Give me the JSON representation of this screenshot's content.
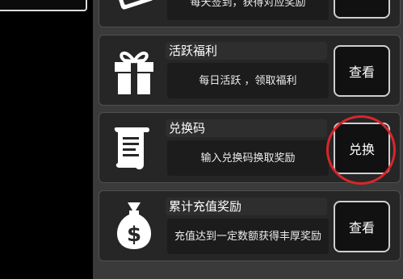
{
  "cards": [
    {
      "title": "",
      "desc": "每天签到，获得对应奖励",
      "button": "查看",
      "icon": "checkin-icon"
    },
    {
      "title": "活跃福利",
      "desc": "每日活跃 ，领取福利",
      "button": "查看",
      "icon": "gift-icon"
    },
    {
      "title": "兑换码",
      "desc": "输入兑换码换取奖励",
      "button": "兑换",
      "icon": "scroll-icon"
    },
    {
      "title": "累计充值奖励",
      "desc": "充值达到一定数额获得丰厚奖励",
      "button": "查看",
      "icon": "money-bag-icon"
    }
  ],
  "highlight_color": "#d8262c"
}
